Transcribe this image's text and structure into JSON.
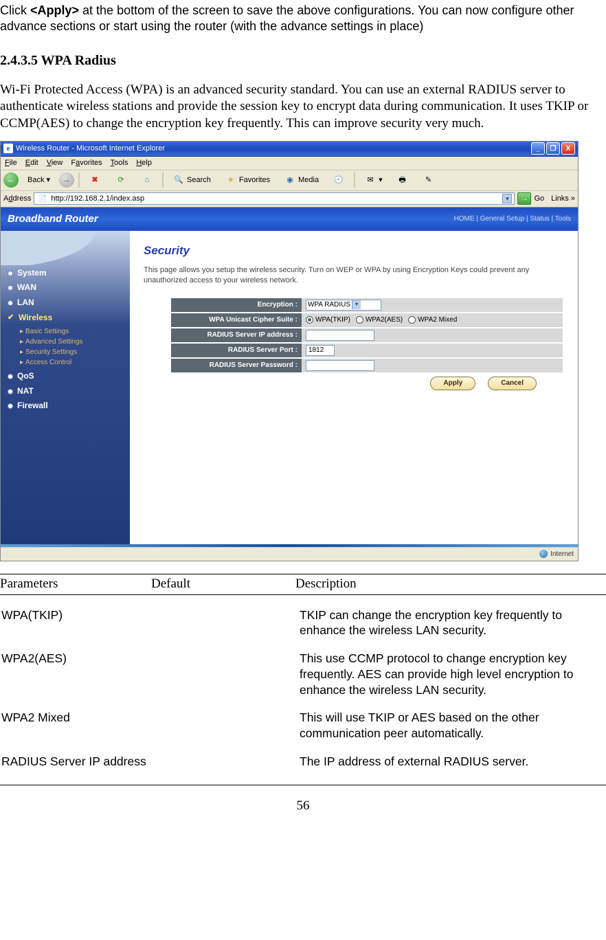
{
  "intro_top_prefix": "Click ",
  "intro_top_bold": "<Apply>",
  "intro_top_suffix": " at the bottom of the screen to save the above configurations. You can now configure other advance sections or start using the router (with the advance settings in place)",
  "section_number": "2.4.3.5 WPA Radius",
  "section_para": "Wi-Fi Protected Access (WPA) is an advanced security standard. You can use an external RADIUS server to authenticate wireless stations and provide the session key to encrypt data during communication. It uses TKIP or CCMP(AES) to change the encryption key frequently. This can improve security very much.",
  "browser": {
    "title": "Wireless Router - Microsoft Internet Explorer",
    "menus": {
      "file": "File",
      "edit": "Edit",
      "view": "View",
      "favorites": "Favorites",
      "tools": "Tools",
      "help": "Help"
    },
    "toolbar": {
      "back": "Back",
      "search": "Search",
      "favorites": "Favorites",
      "media": "Media"
    },
    "address_label": "Address",
    "address_value": "http://192.168.2.1/index.asp",
    "go": "Go",
    "links": "Links",
    "status_right": "Internet"
  },
  "router": {
    "brand": "Broadband Router",
    "toplinks": "HOME | General Setup | Status | Tools",
    "nav": {
      "system": "System",
      "wan": "WAN",
      "lan": "LAN",
      "wireless": "Wireless",
      "qos": "QoS",
      "nat": "NAT",
      "firewall": "Firewall",
      "sub": {
        "basic": "Basic Settings",
        "advanced": "Advanced Settings",
        "security": "Security Settings",
        "access": "Access Control"
      }
    },
    "page": {
      "title": "Security",
      "desc": "This page allows you setup the wireless security. Turn on WEP or WPA by using Encryption Keys could prevent any unauthorized access to your wireless network.",
      "labels": {
        "encryption": "Encryption :",
        "cipher": "WPA Unicast Cipher Suite :",
        "ip": "RADIUS Server IP address :",
        "port": "RADIUS Server Port :",
        "password": "RADIUS Server Password :"
      },
      "values": {
        "encryption": "WPA RADIUS",
        "port": "1812"
      },
      "radios": {
        "tkip": "WPA(TKIP)",
        "aes": "WPA2(AES)",
        "mixed": "WPA2 Mixed"
      },
      "buttons": {
        "apply": "Apply",
        "cancel": "Cancel"
      }
    }
  },
  "table": {
    "headers": {
      "param": "Parameters",
      "default": "Default",
      "desc": "Description"
    },
    "rows": [
      {
        "param": "WPA(TKIP)",
        "desc": "TKIP can change the encryption key frequently to enhance the wireless LAN security."
      },
      {
        "param": "WPA2(AES)",
        "desc": "This use CCMP protocol to change encryption key frequently. AES can provide high level encryption to enhance the wireless LAN security."
      },
      {
        "param": "WPA2 Mixed",
        "desc": "This will use TKIP or AES based on the other communication peer automatically."
      },
      {
        "param": "RADIUS Server IP address",
        "desc": "The IP address of external RADIUS server."
      }
    ]
  },
  "page_number": "56"
}
